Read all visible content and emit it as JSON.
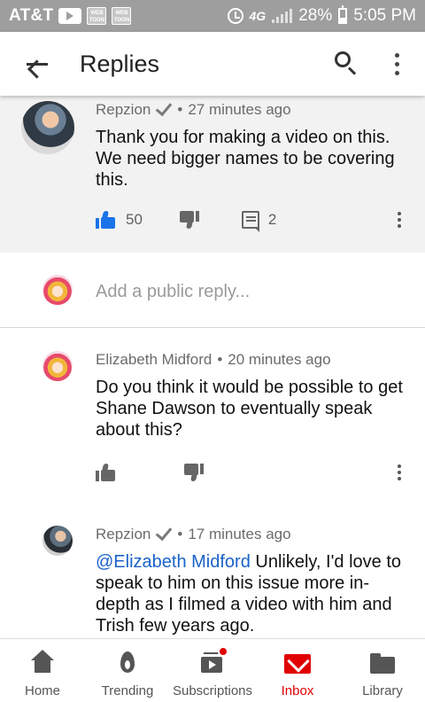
{
  "status_bar": {
    "carrier": "AT&T",
    "network": "4G",
    "battery": "28%",
    "time": "5:05 PM",
    "webtoon_label": "WEB TOON"
  },
  "app_bar": {
    "title": "Replies"
  },
  "main_comment": {
    "author": "Repzion",
    "time": "27 minutes ago",
    "text": "Thank you for making a video on this. We need bigger names to be covering this.",
    "likes": "50",
    "replies": "2"
  },
  "reply_box": {
    "placeholder": "Add a public reply..."
  },
  "replies": [
    {
      "author": "Elizabeth Midford",
      "time": "20 minutes ago",
      "text": "Do you think it would be possible to get Shane Dawson to eventually speak about this?"
    },
    {
      "author": "Repzion",
      "time": "17 minutes ago",
      "mention": "@Elizabeth Midford",
      "text": " Unlikely, I'd love to speak to him on this issue more in-depth as I filmed a video with him and Trish few years ago."
    }
  ],
  "bottom_nav": [
    {
      "label": "Home",
      "icon": "home-icon"
    },
    {
      "label": "Trending",
      "icon": "flame-icon"
    },
    {
      "label": "Subscriptions",
      "icon": "subscriptions-icon"
    },
    {
      "label": "Inbox",
      "icon": "inbox-icon",
      "active": true
    },
    {
      "label": "Library",
      "icon": "folder-icon"
    }
  ],
  "colors": {
    "accent": "#1a73e8",
    "brand_red": "#e00000",
    "mention": "#1a62c9"
  }
}
